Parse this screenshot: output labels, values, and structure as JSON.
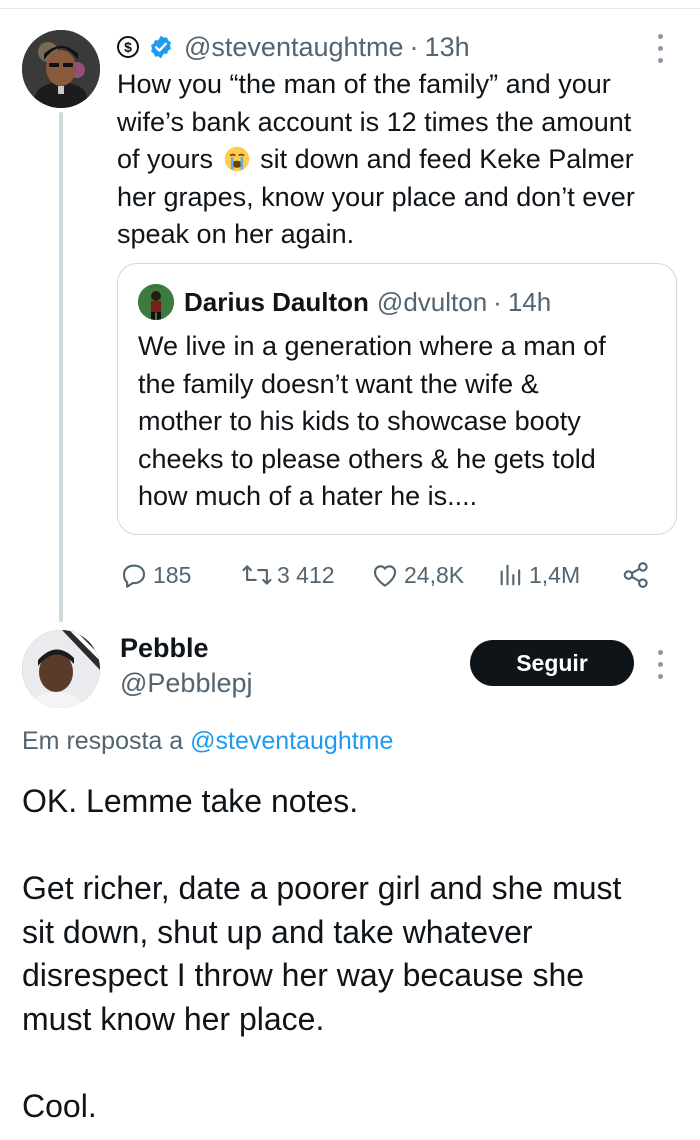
{
  "tweet": {
    "handle": "@steventaughtme",
    "separator": "·",
    "time": "13h",
    "text_line1": "How you “the man of the family” and your",
    "text_line2": "wife’s bank account is 12 times the amount",
    "text_line3_before_emoji": "of yours",
    "text_line3_after_emoji": "sit down and feed Keke Palmer",
    "text_line4": "her grapes, know your place and don’t ever",
    "text_line5": "speak on her again.",
    "emoji": "crying-face",
    "icons": [
      "subscriber-icon",
      "verified-badge-icon",
      "more-icon"
    ],
    "accent_color": "#1d9bf0"
  },
  "quoted_tweet": {
    "name": "Darius Daulton",
    "handle": "@dvulton",
    "separator": "·",
    "time": "14h",
    "lines": [
      "We live in a generation where a man of",
      "the family doesn’t want the wife &",
      "mother to his kids to showcase booty",
      "cheeks to please others & he gets told",
      "how much of a hater he is...."
    ]
  },
  "actions": {
    "replies": "185",
    "retweets": "3 412",
    "likes": "24,8K",
    "views": "1,4M",
    "icons": [
      "reply-icon",
      "retweet-icon",
      "like-icon",
      "views-icon",
      "share-icon"
    ]
  },
  "reply": {
    "name": "Pebble",
    "handle": "@Pebblepj",
    "follow_label": "Seguir",
    "replying_prefix": "Em resposta a",
    "replying_handle": "@steventaughtme",
    "paragraph1": "OK. Lemme take notes.",
    "paragraph2_lines": [
      "Get richer, date a poorer girl and she must",
      "sit down, shut up and take whatever",
      "disrespect I throw her way because she",
      "must know her place."
    ],
    "paragraph3": "Cool."
  }
}
